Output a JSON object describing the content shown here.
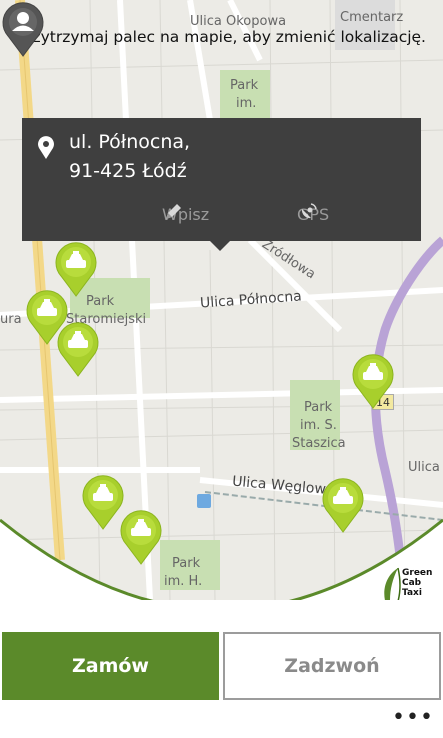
{
  "hint": "Przytrzymaj palec na mapie, aby zmienić lokalizację.",
  "popup": {
    "address_line1": "ul. Północna,",
    "address_line2": "91-425 Łódź",
    "type_label": "Wpisz",
    "gps_label": "GPS"
  },
  "map_labels": {
    "ulica_okopowa": "Ulica Okopowa",
    "cmentarz": "Cmentarz",
    "park_top_1": "Park",
    "park_top_2": "im.",
    "zrodlowa": "Źródłowa",
    "ulica_polnocna": "Ulica Północna",
    "park_staromiejski_1": "Park",
    "park_staromiejski_2": "Staromiejski",
    "ura": "ura",
    "park_staszica_1": "Park",
    "park_staszica_2": "im. S.",
    "park_staszica_3": "Staszica",
    "ulica_weglowa": "Ulica Węglowa",
    "ulica_right": "Ulica",
    "road_number": "14",
    "park_h_1": "Park",
    "park_h_2": "im. H."
  },
  "logo": {
    "text_line1": "Green",
    "text_line2": "Cab",
    "text_line3": "Taxi"
  },
  "buttons": {
    "order": "Zamów",
    "call": "Zadzwoń",
    "more": "•••"
  },
  "colors": {
    "order_bg": "#5b8a2a",
    "taxi_pin": "#a8cf2c",
    "popup_bg": "#3f3f3f",
    "route_purple": "#b9a3d6"
  }
}
